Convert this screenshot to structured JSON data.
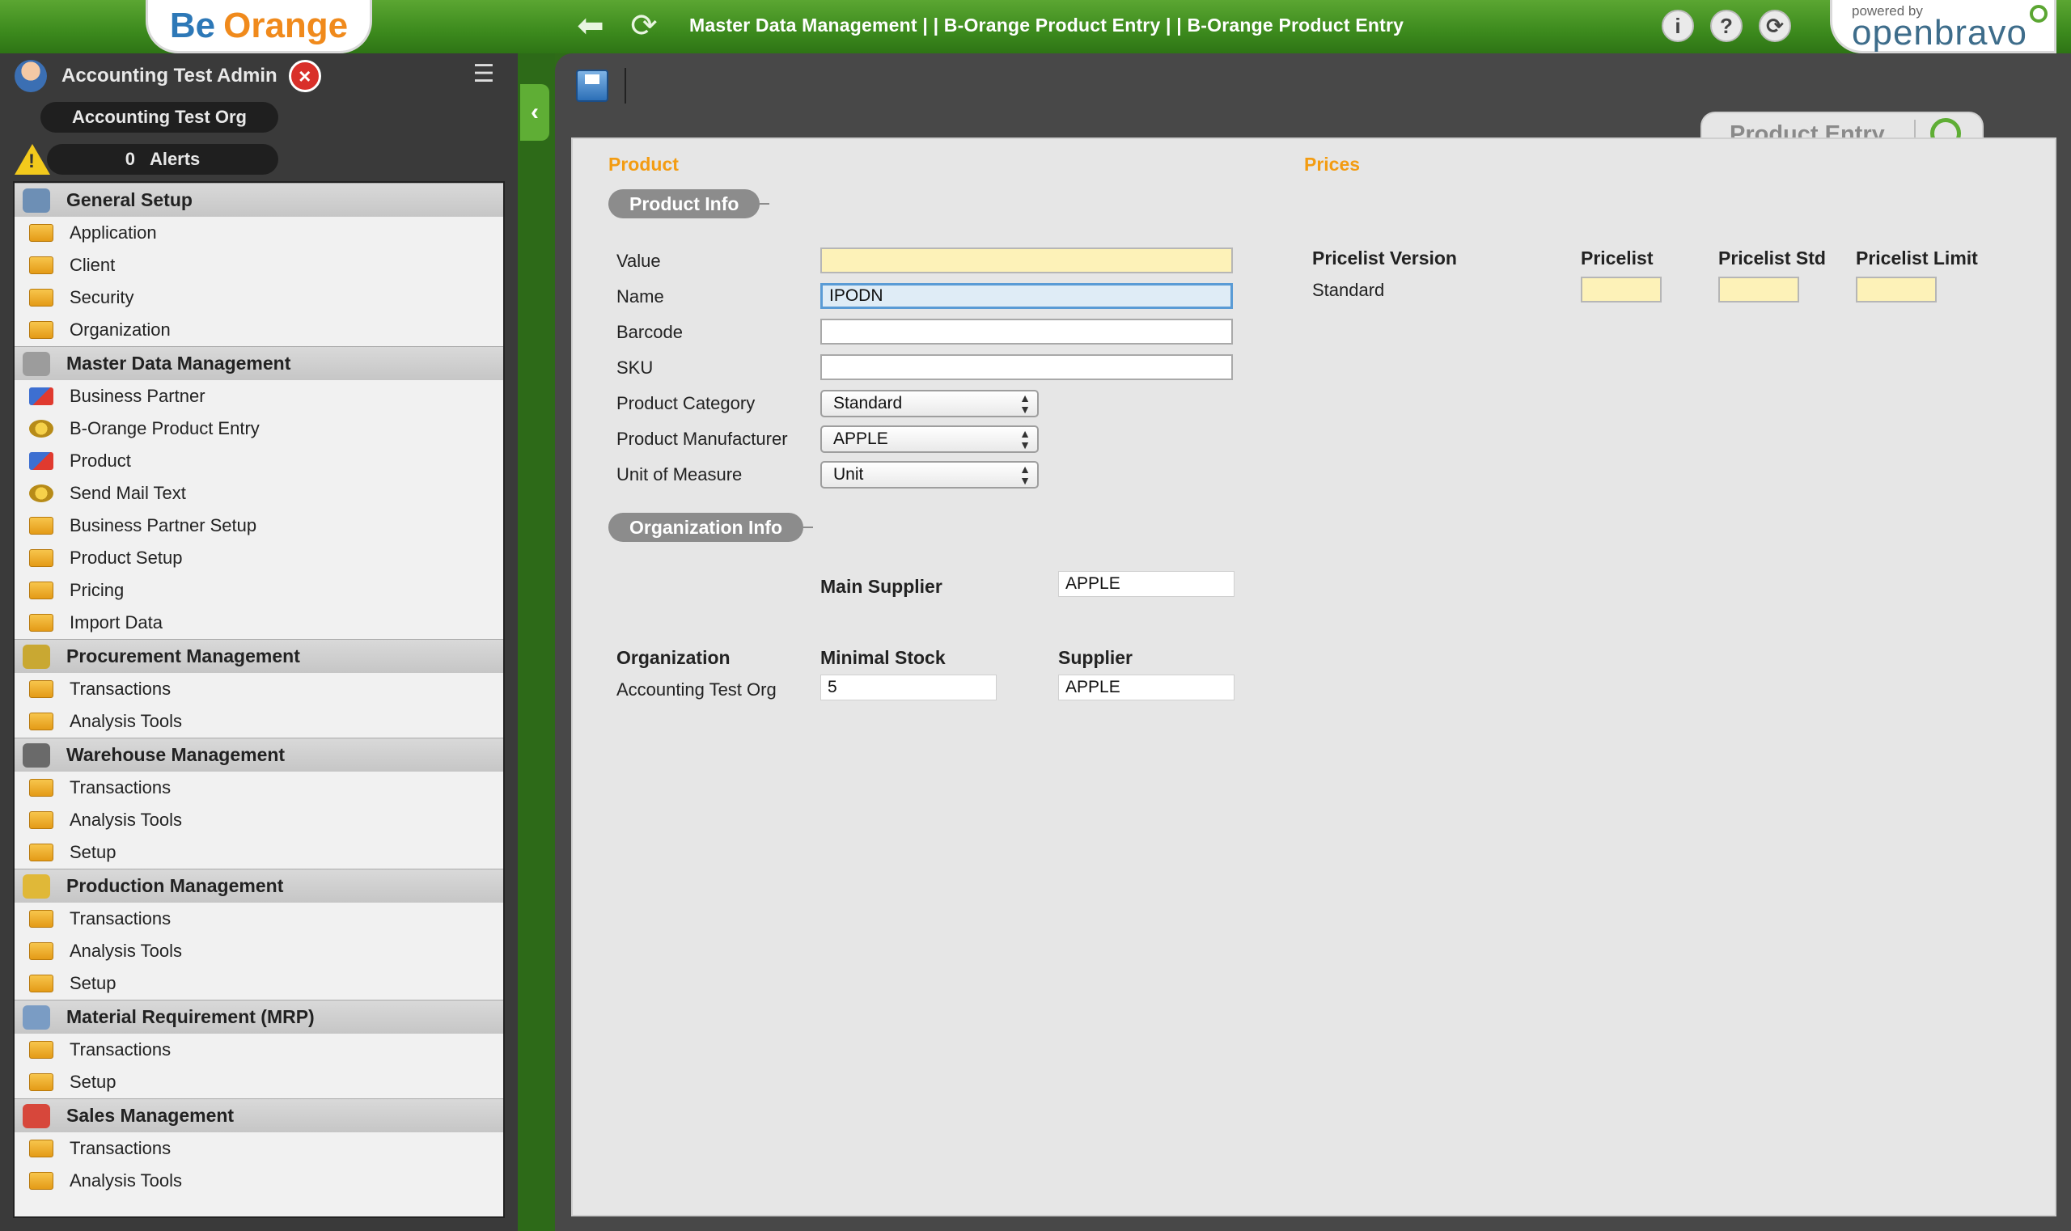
{
  "header": {
    "logo_left": {
      "part1": "Be",
      "part2": "Orange"
    },
    "breadcrumb": "Master Data Management | | B-Orange Product Entry  | |  B-Orange Product Entry",
    "icons": {
      "info": "i",
      "help": "?",
      "refresh": "⟳"
    },
    "logo_right": {
      "powered_by": "powered by",
      "brand": "openbravo"
    }
  },
  "user": {
    "name": "Accounting Test Admin",
    "org": "Accounting Test Org",
    "alerts_count": "0",
    "alerts_label": "Alerts"
  },
  "menu": {
    "sections": [
      {
        "label": "General Setup",
        "icon": "general-setup-icon",
        "items": [
          {
            "label": "Application",
            "icon": "folder"
          },
          {
            "label": "Client",
            "icon": "folder"
          },
          {
            "label": "Security",
            "icon": "folder"
          },
          {
            "label": "Organization",
            "icon": "folder"
          }
        ]
      },
      {
        "label": "Master Data Management",
        "icon": "database-icon",
        "items": [
          {
            "label": "Business Partner",
            "icon": "form"
          },
          {
            "label": "B-Orange Product Entry",
            "icon": "process"
          },
          {
            "label": "Product",
            "icon": "form"
          },
          {
            "label": "Send Mail Text",
            "icon": "process"
          },
          {
            "label": "Business Partner Setup",
            "icon": "folder"
          },
          {
            "label": "Product Setup",
            "icon": "folder"
          },
          {
            "label": "Pricing",
            "icon": "folder"
          },
          {
            "label": "Import Data",
            "icon": "folder"
          }
        ]
      },
      {
        "label": "Procurement Management",
        "icon": "procurement-icon",
        "items": [
          {
            "label": "Transactions",
            "icon": "folder"
          },
          {
            "label": "Analysis Tools",
            "icon": "folder"
          }
        ]
      },
      {
        "label": "Warehouse Management",
        "icon": "warehouse-icon",
        "items": [
          {
            "label": "Transactions",
            "icon": "folder"
          },
          {
            "label": "Analysis Tools",
            "icon": "folder"
          },
          {
            "label": "Setup",
            "icon": "folder"
          }
        ]
      },
      {
        "label": "Production Management",
        "icon": "production-icon",
        "items": [
          {
            "label": "Transactions",
            "icon": "folder"
          },
          {
            "label": "Analysis Tools",
            "icon": "folder"
          },
          {
            "label": "Setup",
            "icon": "folder"
          }
        ]
      },
      {
        "label": "Material Requirement (MRP)",
        "icon": "mrp-icon",
        "items": [
          {
            "label": "Transactions",
            "icon": "folder"
          },
          {
            "label": "Setup",
            "icon": "folder"
          }
        ]
      },
      {
        "label": "Sales Management",
        "icon": "sales-icon",
        "items": [
          {
            "label": "Transactions",
            "icon": "folder"
          },
          {
            "label": "Analysis Tools",
            "icon": "folder"
          }
        ]
      }
    ]
  },
  "tab": {
    "label": "Product Entry"
  },
  "form": {
    "product_title": "Product",
    "prices_title": "Prices",
    "product_info_label": "Product Info",
    "fields": {
      "value_label": "Value",
      "value": "",
      "name_label": "Name",
      "name": "IPODN",
      "barcode_label": "Barcode",
      "barcode": "",
      "sku_label": "SKU",
      "sku": "",
      "category_label": "Product Category",
      "category": "Standard",
      "manufacturer_label": "Product Manufacturer",
      "manufacturer": "APPLE",
      "uom_label": "Unit of Measure",
      "uom": "Unit"
    },
    "prices": {
      "version_header": "Pricelist Version",
      "pricelist_header": "Pricelist",
      "std_header": "Pricelist Std",
      "limit_header": "Pricelist Limit",
      "version": "Standard"
    },
    "org_info_label": "Organization Info",
    "main_supplier_label": "Main Supplier",
    "main_supplier": "APPLE",
    "org_header": "Organization",
    "min_stock_header": "Minimal Stock",
    "supplier_header": "Supplier",
    "org_row": {
      "org": "Accounting Test Org",
      "min_stock": "5",
      "supplier": "APPLE"
    }
  },
  "colors": {
    "accent_green": "#3c8a1d",
    "orange_title": "#f39c12",
    "required_yellow": "#fdf2b8"
  }
}
